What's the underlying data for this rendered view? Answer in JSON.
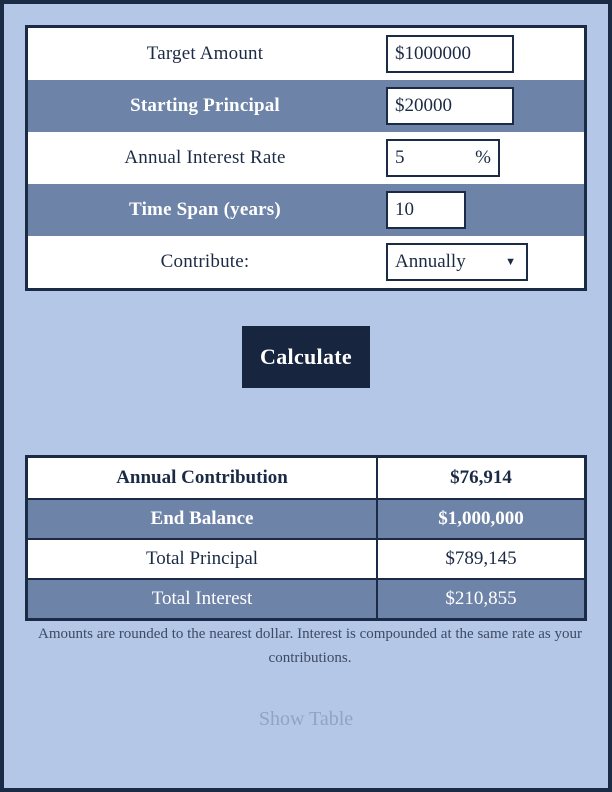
{
  "colors": {
    "page_background": "#b4c7e7",
    "page_border": "#1b2a45",
    "band_row": "#6d83a8",
    "white_row": "#ffffff",
    "text_dark": "#1b2a45",
    "button_background": "#17253f",
    "link_muted": "#8fa4c6"
  },
  "form": {
    "rows": [
      {
        "label": "Target Amount",
        "value": "$1000000",
        "unit": "",
        "type": "text",
        "shaded": false
      },
      {
        "label": "Starting Principal",
        "value": "$20000",
        "unit": "",
        "type": "text",
        "shaded": true
      },
      {
        "label": "Annual Interest Rate",
        "value": "5",
        "unit": "%",
        "type": "text",
        "shaded": false
      },
      {
        "label": "Time Span (years)",
        "value": "10",
        "unit": "",
        "type": "text",
        "shaded": true
      },
      {
        "label": "Contribute:",
        "value": "Annually",
        "unit": "",
        "type": "select",
        "shaded": false,
        "caret": "▼"
      }
    ]
  },
  "actions": {
    "calculate_label": "Calculate",
    "show_table_label": "Show Table"
  },
  "results": {
    "rows": [
      {
        "name": "Annual Contribution",
        "value": "$76,914",
        "shaded": false,
        "bold": true
      },
      {
        "name": "End Balance",
        "value": "$1,000,000",
        "shaded": true,
        "bold": true
      },
      {
        "name": "Total Principal",
        "value": "$789,145",
        "shaded": false,
        "bold": false
      },
      {
        "name": "Total Interest",
        "value": "$210,855",
        "shaded": true,
        "bold": false
      }
    ]
  },
  "footnote": "Amounts are rounded to the nearest dollar. Interest is compounded at the same rate as your contributions."
}
